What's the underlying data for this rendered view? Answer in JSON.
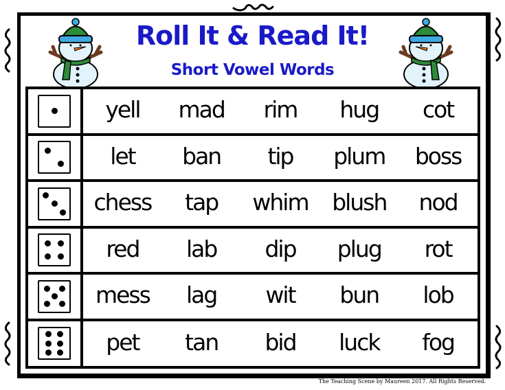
{
  "header": {
    "title": "Roll It & Read It!",
    "subtitle": "Short Vowel Words"
  },
  "rows": [
    {
      "die": 1,
      "words": [
        "yell",
        "mad",
        "rim",
        "hug",
        "cot"
      ]
    },
    {
      "die": 2,
      "words": [
        "let",
        "ban",
        "tip",
        "plum",
        "boss"
      ]
    },
    {
      "die": 3,
      "words": [
        "chess",
        "tap",
        "whim",
        "blush",
        "nod"
      ]
    },
    {
      "die": 4,
      "words": [
        "red",
        "lab",
        "dip",
        "plug",
        "rot"
      ]
    },
    {
      "die": 5,
      "words": [
        "mess",
        "lag",
        "wit",
        "bun",
        "lob"
      ]
    },
    {
      "die": 6,
      "words": [
        "pet",
        "tan",
        "bid",
        "luck",
        "fog"
      ]
    }
  ],
  "footer": "The Teaching Scene by Maureen 2017. All Rights Reserved.",
  "icons": {
    "left_illustration": "snowman-icon",
    "right_illustration": "snowman-icon",
    "decor": "curly-swirl-icon"
  },
  "colors": {
    "title": "#1a1ac8",
    "hat_green": "#2e8b3a",
    "hat_blue": "#3fa9e0",
    "snow": "#e3f3fb",
    "carrot": "#f07b1e",
    "branch": "#6b3b1f"
  }
}
